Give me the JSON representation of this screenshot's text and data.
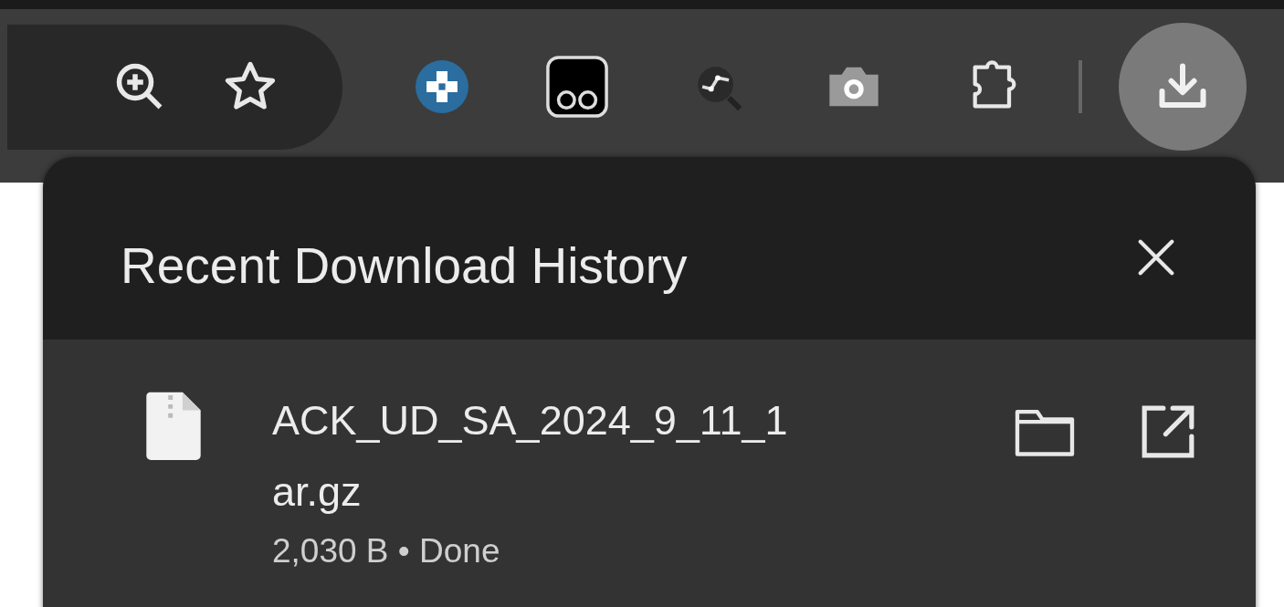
{
  "downloads_panel": {
    "title": "Recent Download History",
    "items": [
      {
        "name_lines": [
          "ACK_UD_SA_2024_9_11_1",
          "ar.gz"
        ],
        "status": "2,030 B • Done"
      }
    ]
  }
}
